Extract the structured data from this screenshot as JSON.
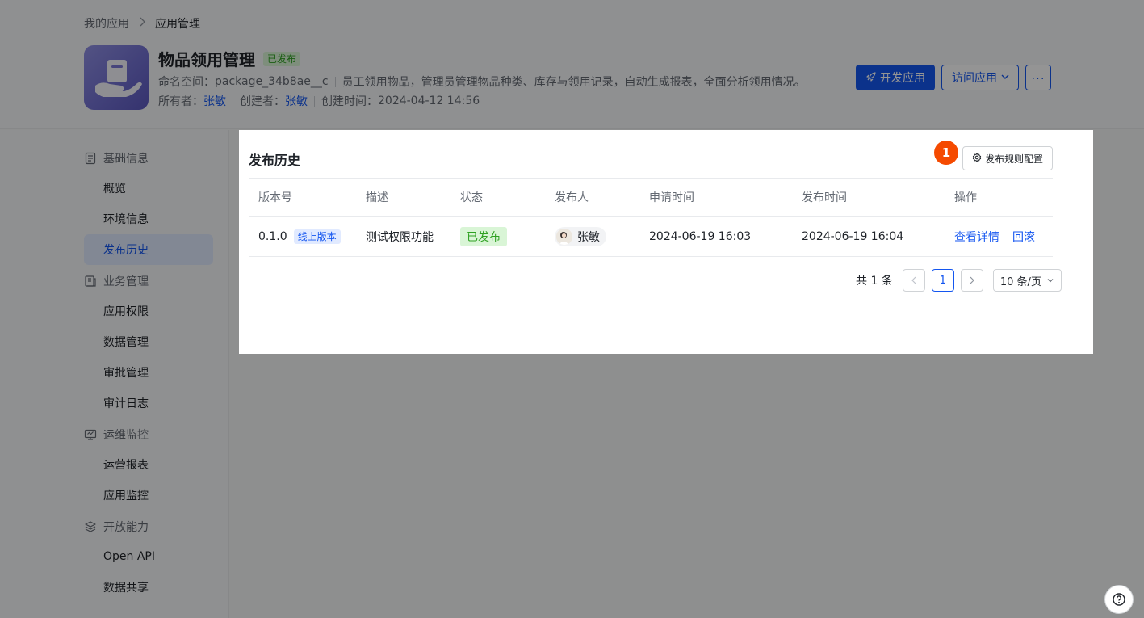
{
  "breadcrumb": {
    "parent": "我的应用",
    "current": "应用管理"
  },
  "app": {
    "name": "物品领用管理",
    "status": "已发布",
    "namespace_label": "命名空间：",
    "namespace": "package_34b8ae__c",
    "description": "员工领用物品，管理员管理物品种类、库存与领用记录，自动生成报表，全面分析领用情况。",
    "owner_label": "所有者：",
    "owner": "张敏",
    "creator_label": "创建者：",
    "creator": "张敏",
    "created_label": "创建时间：",
    "created_at": "2024-04-12 14:56"
  },
  "header_actions": {
    "develop": "开发应用",
    "visit": "访问应用",
    "more": "···"
  },
  "sidebar": {
    "groups": [
      {
        "label": "基础信息",
        "icon": "doc-icon",
        "items": [
          "概览",
          "环境信息",
          "发布历史"
        ]
      },
      {
        "label": "业务管理",
        "icon": "briefcase-icon",
        "items": [
          "应用权限",
          "数据管理",
          "审批管理",
          "审计日志"
        ]
      },
      {
        "label": "运维监控",
        "icon": "monitor-icon",
        "items": [
          "运营报表",
          "应用监控"
        ]
      },
      {
        "label": "开放能力",
        "icon": "layers-icon",
        "items": [
          "Open API",
          "数据共享"
        ]
      }
    ],
    "active": "发布历史"
  },
  "card": {
    "title": "发布历史",
    "step_badge": "1",
    "config_button": "发布规则配置"
  },
  "table": {
    "headers": [
      "版本号",
      "描述",
      "状态",
      "发布人",
      "申请时间",
      "发布时间",
      "操作"
    ],
    "rows": [
      {
        "version": "0.1.0",
        "version_tag": "线上版本",
        "description": "测试权限功能",
        "status": "已发布",
        "publisher": "张敏",
        "applied_at": "2024-06-19 16:03",
        "published_at": "2024-06-19 16:04",
        "actions": [
          "查看详情",
          "回滚"
        ]
      }
    ]
  },
  "pagination": {
    "total": "共 1 条",
    "current_page": "1",
    "page_size": "10 条/页"
  },
  "colors": {
    "primary": "#1456f0",
    "success": "#2ea121",
    "badge": "#f54a00"
  }
}
